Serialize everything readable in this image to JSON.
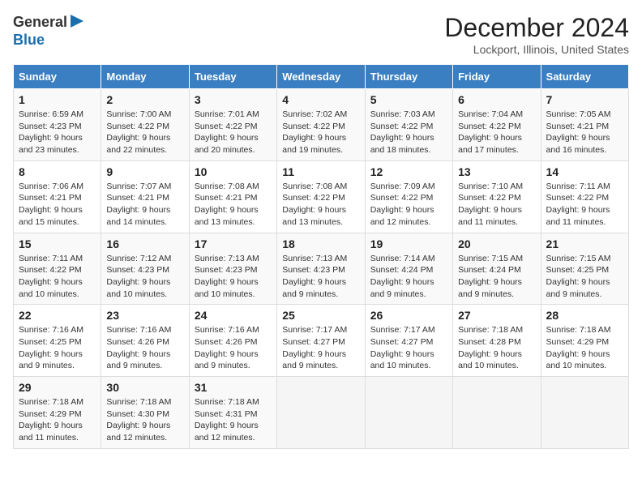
{
  "logo": {
    "line1": "General",
    "line2": "Blue"
  },
  "title": "December 2024",
  "location": "Lockport, Illinois, United States",
  "weekdays": [
    "Sunday",
    "Monday",
    "Tuesday",
    "Wednesday",
    "Thursday",
    "Friday",
    "Saturday"
  ],
  "weeks": [
    [
      {
        "day": "1",
        "sunrise": "6:59 AM",
        "sunset": "4:23 PM",
        "daylight": "9 hours and 23 minutes."
      },
      {
        "day": "2",
        "sunrise": "7:00 AM",
        "sunset": "4:22 PM",
        "daylight": "9 hours and 22 minutes."
      },
      {
        "day": "3",
        "sunrise": "7:01 AM",
        "sunset": "4:22 PM",
        "daylight": "9 hours and 20 minutes."
      },
      {
        "day": "4",
        "sunrise": "7:02 AM",
        "sunset": "4:22 PM",
        "daylight": "9 hours and 19 minutes."
      },
      {
        "day": "5",
        "sunrise": "7:03 AM",
        "sunset": "4:22 PM",
        "daylight": "9 hours and 18 minutes."
      },
      {
        "day": "6",
        "sunrise": "7:04 AM",
        "sunset": "4:22 PM",
        "daylight": "9 hours and 17 minutes."
      },
      {
        "day": "7",
        "sunrise": "7:05 AM",
        "sunset": "4:21 PM",
        "daylight": "9 hours and 16 minutes."
      }
    ],
    [
      {
        "day": "8",
        "sunrise": "7:06 AM",
        "sunset": "4:21 PM",
        "daylight": "9 hours and 15 minutes."
      },
      {
        "day": "9",
        "sunrise": "7:07 AM",
        "sunset": "4:21 PM",
        "daylight": "9 hours and 14 minutes."
      },
      {
        "day": "10",
        "sunrise": "7:08 AM",
        "sunset": "4:21 PM",
        "daylight": "9 hours and 13 minutes."
      },
      {
        "day": "11",
        "sunrise": "7:08 AM",
        "sunset": "4:22 PM",
        "daylight": "9 hours and 13 minutes."
      },
      {
        "day": "12",
        "sunrise": "7:09 AM",
        "sunset": "4:22 PM",
        "daylight": "9 hours and 12 minutes."
      },
      {
        "day": "13",
        "sunrise": "7:10 AM",
        "sunset": "4:22 PM",
        "daylight": "9 hours and 11 minutes."
      },
      {
        "day": "14",
        "sunrise": "7:11 AM",
        "sunset": "4:22 PM",
        "daylight": "9 hours and 11 minutes."
      }
    ],
    [
      {
        "day": "15",
        "sunrise": "7:11 AM",
        "sunset": "4:22 PM",
        "daylight": "9 hours and 10 minutes."
      },
      {
        "day": "16",
        "sunrise": "7:12 AM",
        "sunset": "4:23 PM",
        "daylight": "9 hours and 10 minutes."
      },
      {
        "day": "17",
        "sunrise": "7:13 AM",
        "sunset": "4:23 PM",
        "daylight": "9 hours and 10 minutes."
      },
      {
        "day": "18",
        "sunrise": "7:13 AM",
        "sunset": "4:23 PM",
        "daylight": "9 hours and 9 minutes."
      },
      {
        "day": "19",
        "sunrise": "7:14 AM",
        "sunset": "4:24 PM",
        "daylight": "9 hours and 9 minutes."
      },
      {
        "day": "20",
        "sunrise": "7:15 AM",
        "sunset": "4:24 PM",
        "daylight": "9 hours and 9 minutes."
      },
      {
        "day": "21",
        "sunrise": "7:15 AM",
        "sunset": "4:25 PM",
        "daylight": "9 hours and 9 minutes."
      }
    ],
    [
      {
        "day": "22",
        "sunrise": "7:16 AM",
        "sunset": "4:25 PM",
        "daylight": "9 hours and 9 minutes."
      },
      {
        "day": "23",
        "sunrise": "7:16 AM",
        "sunset": "4:26 PM",
        "daylight": "9 hours and 9 minutes."
      },
      {
        "day": "24",
        "sunrise": "7:16 AM",
        "sunset": "4:26 PM",
        "daylight": "9 hours and 9 minutes."
      },
      {
        "day": "25",
        "sunrise": "7:17 AM",
        "sunset": "4:27 PM",
        "daylight": "9 hours and 9 minutes."
      },
      {
        "day": "26",
        "sunrise": "7:17 AM",
        "sunset": "4:27 PM",
        "daylight": "9 hours and 10 minutes."
      },
      {
        "day": "27",
        "sunrise": "7:18 AM",
        "sunset": "4:28 PM",
        "daylight": "9 hours and 10 minutes."
      },
      {
        "day": "28",
        "sunrise": "7:18 AM",
        "sunset": "4:29 PM",
        "daylight": "9 hours and 10 minutes."
      }
    ],
    [
      {
        "day": "29",
        "sunrise": "7:18 AM",
        "sunset": "4:29 PM",
        "daylight": "9 hours and 11 minutes."
      },
      {
        "day": "30",
        "sunrise": "7:18 AM",
        "sunset": "4:30 PM",
        "daylight": "9 hours and 12 minutes."
      },
      {
        "day": "31",
        "sunrise": "7:18 AM",
        "sunset": "4:31 PM",
        "daylight": "9 hours and 12 minutes."
      },
      null,
      null,
      null,
      null
    ]
  ],
  "labels": {
    "sunrise": "Sunrise:",
    "sunset": "Sunset:",
    "daylight": "Daylight:"
  }
}
